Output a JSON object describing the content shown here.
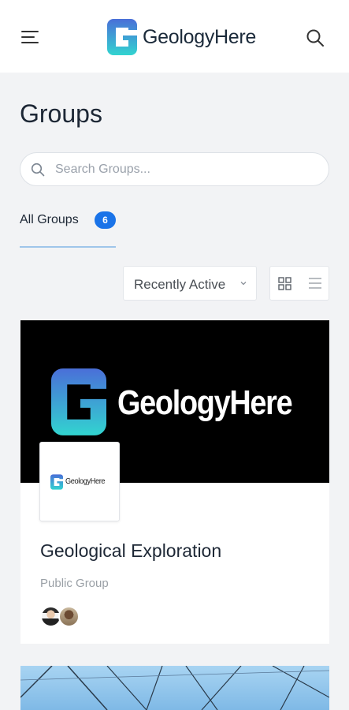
{
  "header": {
    "brand": "GeologyHere",
    "logo_letter": "G",
    "icons": {
      "menu": "hamburger-menu-icon",
      "search": "search-icon"
    }
  },
  "page": {
    "title": "Groups"
  },
  "search": {
    "placeholder": "Search Groups..."
  },
  "tabs": [
    {
      "label": "All Groups",
      "count": "6"
    }
  ],
  "sort": {
    "selected": "Recently Active"
  },
  "view_toggle": {
    "grid": "grid-view-icon",
    "list": "list-view-icon",
    "active": "grid"
  },
  "groups": [
    {
      "cover_brand": "GeologyHere",
      "avatar_brand": "GeologyHere",
      "title": "Geological Exploration",
      "type": "Public Group",
      "member_count_shown": 2
    }
  ],
  "colors": {
    "accent": "#1a73e8",
    "tab_underline": "#9fc5ea",
    "logo_gradient_top": "#4a6fd8",
    "logo_gradient_bottom": "#32d4d0"
  }
}
